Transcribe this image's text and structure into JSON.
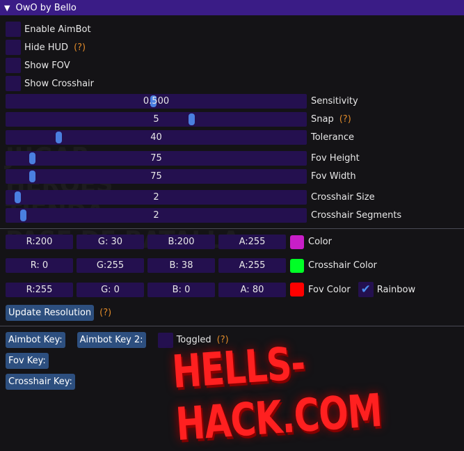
{
  "window": {
    "title": "OwO by Bello"
  },
  "checkboxes": [
    {
      "label": "Enable AimBot",
      "checked": false,
      "help": ""
    },
    {
      "label": "Hide HUD",
      "checked": false,
      "help": "(?)"
    },
    {
      "label": "Show FOV",
      "checked": false,
      "help": ""
    },
    {
      "label": "Show Crosshair",
      "checked": false,
      "help": ""
    }
  ],
  "sliders": [
    {
      "label": "Sensitivity",
      "value": "0.500",
      "fraction": 0.49,
      "help": ""
    },
    {
      "label": "Snap",
      "value": "5",
      "fraction": 0.62,
      "help": "(?)"
    },
    {
      "label": "Tolerance",
      "value": "40",
      "fraction": 0.17,
      "help": ""
    },
    {
      "label": "Fov Height",
      "value": "75",
      "fraction": 0.08,
      "help": ""
    },
    {
      "label": "Fov Width",
      "value": "75",
      "fraction": 0.08,
      "help": ""
    },
    {
      "label": "Crosshair Size",
      "value": "2",
      "fraction": 0.03,
      "help": ""
    },
    {
      "label": "Crosshair Segments",
      "value": "2",
      "fraction": 0.05,
      "help": ""
    }
  ],
  "colors": [
    {
      "label": "Color",
      "channels": [
        "R:200",
        "G: 30",
        "B:200",
        "A:255"
      ],
      "swatch": "#c81ec8"
    },
    {
      "label": "Crosshair Color",
      "channels": [
        "R:  0",
        "G:255",
        "B: 38",
        "A:255"
      ],
      "swatch": "#00ff26"
    },
    {
      "label": "Fov Color",
      "channels": [
        "R:255",
        "G:  0",
        "B:  0",
        "A: 80"
      ],
      "swatch": "#ff0000"
    }
  ],
  "rainbow": {
    "label": "Rainbow",
    "checked": true
  },
  "update_resolution": {
    "label": "Update Resolution",
    "help": "(?)"
  },
  "keys": {
    "aimbot": "Aimbot Key:",
    "aimbot2": "Aimbot Key 2:",
    "toggled": "Toggled",
    "toggled_help": "(?)",
    "fov": "Fov Key:",
    "crosshair": "Crosshair Key:"
  },
  "watermark": "HELLS-HACK.COM",
  "colors_theme": {
    "title_bar": "#3a1c86",
    "frame": "#24104f",
    "grab": "#4a7fe0",
    "button": "#2d4f7f",
    "help": "#e08a2a"
  }
}
